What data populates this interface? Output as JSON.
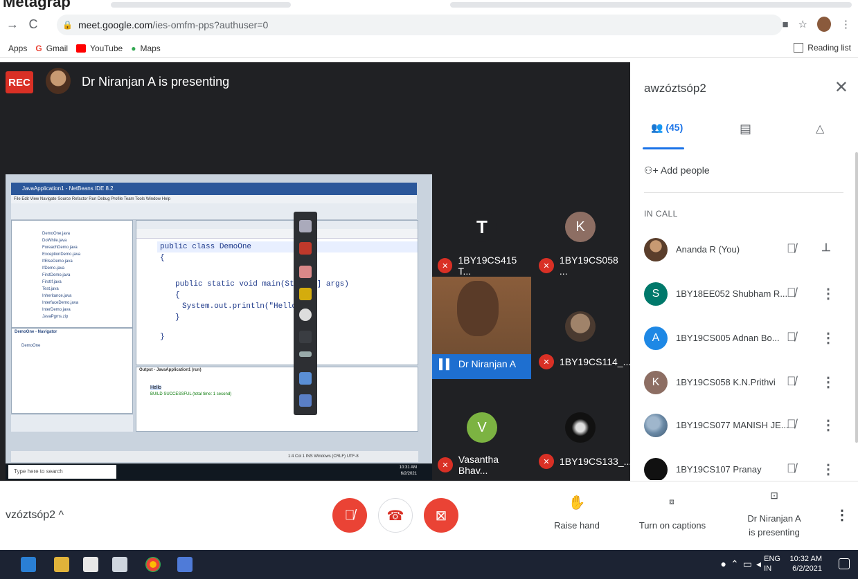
{
  "top_strip": {
    "label": "Metagrap"
  },
  "browser": {
    "url_host": "meet.google.com",
    "url_path": "/ies-omfm-pps?authuser=0",
    "bookmarks": [
      {
        "label": "Apps",
        "color": "#4285f4"
      },
      {
        "label": "Gmail",
        "color": "#ea4335"
      },
      {
        "label": "YouTube",
        "color": "#ff0000"
      },
      {
        "label": "Maps",
        "color": "#34a853"
      }
    ],
    "reading_list": "Reading list"
  },
  "stage": {
    "rec": "REC",
    "presenting_text": "Dr Niranjan A is presenting"
  },
  "share": {
    "window_title": "JavaApplication1 - NetBeans IDE 8.2",
    "menu": "File  Edit  View  Navigate  Source  Refactor  Run  Debug  Profile  Team  Tools  Window  Help",
    "code_line1": "public class DemoOne",
    "code_line2": "{",
    "code_line3": "public static void main(String[] args)",
    "code_line4": "{",
    "code_line5": "System.out.println(\"Hello\");",
    "code_line6": "}",
    "code_line7": "}",
    "output_title": "Output - JavaApplication1 (run)",
    "output_line1": "Hello",
    "output_line2": "BUILD SUCCESSFUL (total time: 1 second)",
    "status": "1:4  Col 1     INS     Windows (CRLF)     UTF-8",
    "taskbar_search": "Type here to search",
    "taskbar_time": "10:31 AM",
    "taskbar_date": "6/2/2021",
    "tree_items": [
      "DemoOne.java",
      "DoWhile.java",
      "ForeachDemo.java",
      "ExceptionDemo.java",
      "IfElseDemo.java",
      "IfDemo.java",
      "FirstDemo.java",
      "FirstIf.java",
      "Test.java",
      "Inheritance.java",
      "InterfaceDemo.java",
      "InterDemo.java",
      "JavaPgms.zip"
    ],
    "navigator_title": "DemoOne - Navigator",
    "navigator_item": "DemoOne"
  },
  "tiles": [
    {
      "name": "1BY19CS415 T...",
      "initial": "T",
      "color": "#202124"
    },
    {
      "name": "1BY19CS058 ...",
      "initial": "K",
      "color": "#8d6e63"
    },
    {
      "name": "1BY19CS114_...",
      "initial": "",
      "color": "#8a6d5a"
    },
    {
      "name": "Vasantha Bhav...",
      "initial": "V",
      "color": "#7cb342"
    },
    {
      "name": "1BY19CS133_...",
      "initial": "",
      "color": "#111111"
    }
  ],
  "video_tile": {
    "name": "Dr Niranjan A"
  },
  "panel": {
    "meeting_code": "awzóztsóp2",
    "people_count": "(45)",
    "add_people": "Add people",
    "in_call": "IN CALL",
    "people": [
      {
        "name": "Ananda R (You)",
        "initial": "",
        "color": "#5a3e2b"
      },
      {
        "name": "1BY18EE052 Shubham R...",
        "initial": "S",
        "color": "#00796b"
      },
      {
        "name": "1BY19CS005 Adnan Bo...",
        "initial": "A",
        "color": "#1e88e5"
      },
      {
        "name": "1BY19CS058 K.N.Prithvi",
        "initial": "K",
        "color": "#8d6e63"
      },
      {
        "name": "1BY19CS077 MANISH JE...",
        "initial": "",
        "color": "#6b8aa6"
      },
      {
        "name": "1BY19CS107 Pranay",
        "initial": "",
        "color": "#111111"
      }
    ]
  },
  "controls": {
    "meeting_code": "vzóztsóp2",
    "raise_hand": "Raise hand",
    "captions": "Turn on captions",
    "presenting_line1": "Dr Niranjan A",
    "presenting_line2": "is presenting"
  },
  "windows": {
    "lang": "ENG",
    "region": "IN",
    "time": "10:32 AM",
    "date": "6/2/2021"
  }
}
